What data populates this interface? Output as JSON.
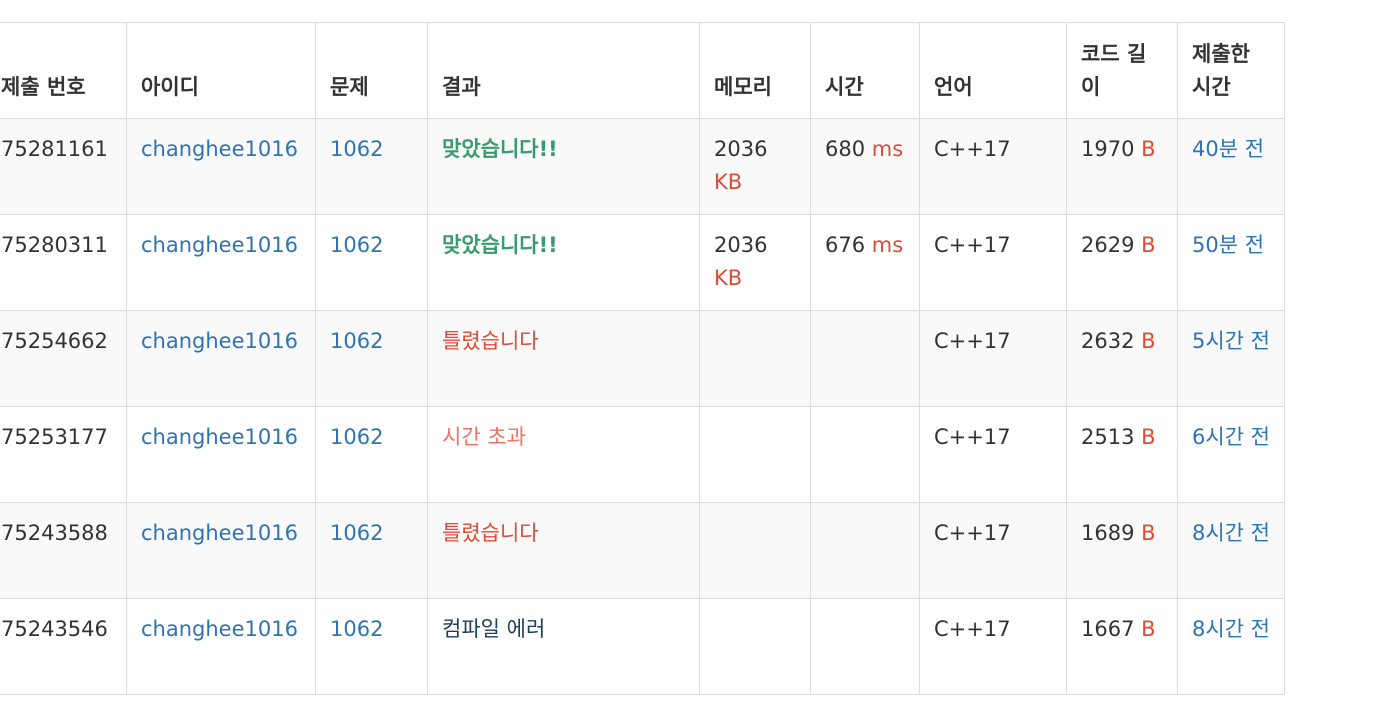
{
  "headers": [
    "제출 번호",
    "아이디",
    "문제",
    "결과",
    "메모리",
    "시간",
    "언어",
    "코드 길이",
    "제출한 시간"
  ],
  "status_colors": {
    "accepted": "#3b9a6e",
    "wrong": "#dd4b39",
    "time_limit": "#f07167",
    "compile_error": "#1f3d5c",
    "link": "#2f73b5",
    "unit": "#dd4b39"
  },
  "rows": [
    {
      "id": "75281161",
      "user": "changhee1016",
      "problem": "1062",
      "result": "맞았습니다!!",
      "result_type": "accepted",
      "memory": "2036",
      "memory_unit": "KB",
      "time": "680",
      "time_unit": "ms",
      "lang": "C++17",
      "code_len": "1970",
      "code_unit": "B",
      "submitted": "40분 전"
    },
    {
      "id": "75280311",
      "user": "changhee1016",
      "problem": "1062",
      "result": "맞았습니다!!",
      "result_type": "accepted",
      "memory": "2036",
      "memory_unit": "KB",
      "time": "676",
      "time_unit": "ms",
      "lang": "C++17",
      "code_len": "2629",
      "code_unit": "B",
      "submitted": "50분 전"
    },
    {
      "id": "75254662",
      "user": "changhee1016",
      "problem": "1062",
      "result": "틀렸습니다",
      "result_type": "wrong",
      "memory": "",
      "memory_unit": "",
      "time": "",
      "time_unit": "",
      "lang": "C++17",
      "code_len": "2632",
      "code_unit": "B",
      "submitted": "5시간 전"
    },
    {
      "id": "75253177",
      "user": "changhee1016",
      "problem": "1062",
      "result": "시간 초과",
      "result_type": "time_limit",
      "memory": "",
      "memory_unit": "",
      "time": "",
      "time_unit": "",
      "lang": "C++17",
      "code_len": "2513",
      "code_unit": "B",
      "submitted": "6시간 전"
    },
    {
      "id": "75243588",
      "user": "changhee1016",
      "problem": "1062",
      "result": "틀렸습니다",
      "result_type": "wrong",
      "memory": "",
      "memory_unit": "",
      "time": "",
      "time_unit": "",
      "lang": "C++17",
      "code_len": "1689",
      "code_unit": "B",
      "submitted": "8시간 전"
    },
    {
      "id": "75243546",
      "user": "changhee1016",
      "problem": "1062",
      "result": "컴파일 에러",
      "result_type": "compile_error",
      "memory": "",
      "memory_unit": "",
      "time": "",
      "time_unit": "",
      "lang": "C++17",
      "code_len": "1667",
      "code_unit": "B",
      "submitted": "8시간 전"
    }
  ]
}
